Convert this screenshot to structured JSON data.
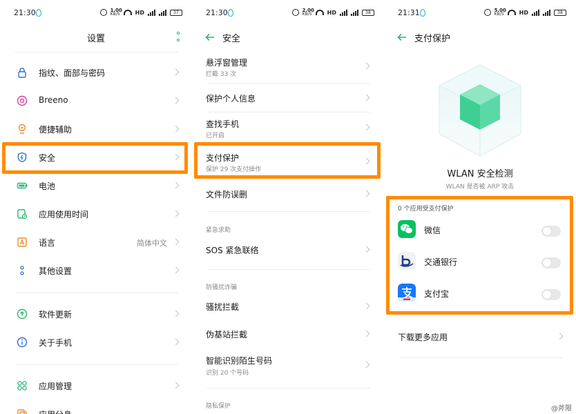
{
  "colors": {
    "accent": "#2bb673",
    "highlight": "#ff8c00",
    "text": "#1a1a1a",
    "subtext": "#8a8a8a"
  },
  "panels": [
    {
      "status": {
        "time": "21:30",
        "speed_top": "1.00",
        "speed_unit": "KB/S",
        "hd": "HD",
        "battery": "37"
      },
      "header": {
        "title": "设置"
      },
      "items": [
        {
          "label": "指纹、面部与密码",
          "icon": "lock-icon"
        },
        {
          "label": "Breeno",
          "icon": "breeno-icon"
        },
        {
          "label": "便捷辅助",
          "icon": "assist-icon"
        },
        {
          "label": "安全",
          "icon": "shield-icon"
        },
        {
          "label": "电池",
          "icon": "battery-icon"
        },
        {
          "label": "应用使用时间",
          "icon": "hourglass-icon"
        },
        {
          "label": "语言",
          "value": "简体中文",
          "icon": "language-icon"
        },
        {
          "label": "其他设置",
          "icon": "more-settings-icon"
        },
        {
          "label": "软件更新",
          "icon": "update-icon"
        },
        {
          "label": "关于手机",
          "icon": "info-icon"
        },
        {
          "label": "应用管理",
          "icon": "apps-icon"
        },
        {
          "label": "应用分身",
          "icon": "clone-icon"
        }
      ]
    },
    {
      "status": {
        "time": "21:30",
        "speed_top": "2.00",
        "speed_unit": "KB/S",
        "hd": "HD",
        "battery": "38"
      },
      "header": {
        "title": "安全"
      },
      "items": [
        {
          "label": "悬浮窗管理",
          "sub": "拦截 33 次"
        },
        {
          "label": "保护个人信息"
        },
        {
          "label": "查找手机",
          "sub": "已开启"
        },
        {
          "label": "支付保护",
          "sub": "保护 29 次支付操作"
        },
        {
          "label": "文件防误删"
        },
        {
          "label": "SOS 紧急联络"
        },
        {
          "label": "骚扰拦截"
        },
        {
          "label": "伪基站拦截"
        },
        {
          "label": "智能识别陌生号码",
          "sub": "识别 20 个号码"
        }
      ],
      "sections": {
        "emergency": "紧急求助",
        "harass": "防骚扰诈骗",
        "privacy": "隐私保护"
      }
    },
    {
      "status": {
        "time": "21:31",
        "speed_top": "5.00",
        "speed_unit": "KB/S",
        "hd": "HD",
        "battery": "38"
      },
      "header": {
        "title": "支付保护"
      },
      "wlan": {
        "title": "WLAN 安全检测",
        "sub": "WLAN 是否被 ARP 攻击"
      },
      "protected_count": "0 个应用受支付保护",
      "apps": [
        {
          "label": "微信",
          "icon": "wechat-icon",
          "enabled": false
        },
        {
          "label": "交通银行",
          "icon": "bocom-icon",
          "enabled": false
        },
        {
          "label": "支付宝",
          "icon": "alipay-icon",
          "enabled": false
        }
      ],
      "download_more": "下载更多应用",
      "watermark": "@斧限"
    }
  ]
}
